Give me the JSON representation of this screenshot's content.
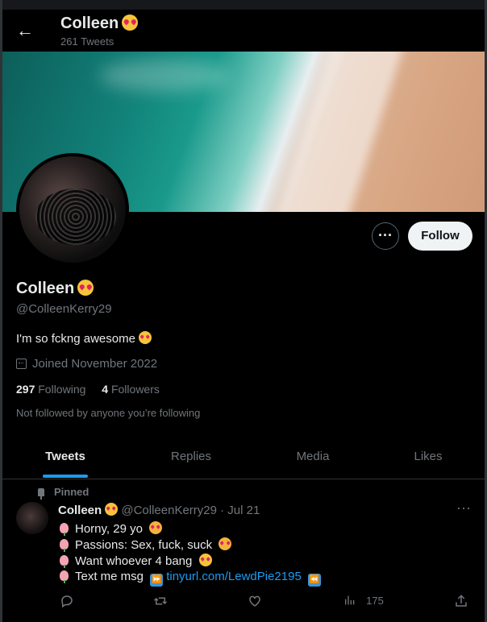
{
  "header": {
    "name": "Colleen",
    "tweet_count": "261 Tweets"
  },
  "profile": {
    "name": "Colleen",
    "handle": "@ColleenKerry29",
    "bio": "I'm so fckng awesome",
    "joined": "Joined November 2022",
    "following_count": "297",
    "following_label": "Following",
    "followers_count": "4",
    "followers_label": "Followers",
    "not_followed": "Not followed by anyone you’re following",
    "follow_label": "Follow"
  },
  "tabs": [
    {
      "label": "Tweets",
      "active": true
    },
    {
      "label": "Replies"
    },
    {
      "label": "Media"
    },
    {
      "label": "Likes"
    }
  ],
  "tweet": {
    "pinned_label": "Pinned",
    "name": "Colleen",
    "handle_date": "@ColleenKerry29 · Jul 21",
    "lines": [
      "Horny, 29 yo",
      "Passions: Sex, fuck, suck",
      "Want whoever 4 bang",
      "Text me msg"
    ],
    "link": "tinyurl.com/LewdPie2195",
    "views": "175"
  },
  "colors": {
    "accent": "#1d9bf0",
    "background": "#000000",
    "muted": "#71767b"
  },
  "icons": [
    "back-arrow-icon",
    "calendar-icon",
    "pin-icon",
    "reply-icon",
    "retweet-icon",
    "like-icon",
    "views-icon",
    "share-icon"
  ]
}
